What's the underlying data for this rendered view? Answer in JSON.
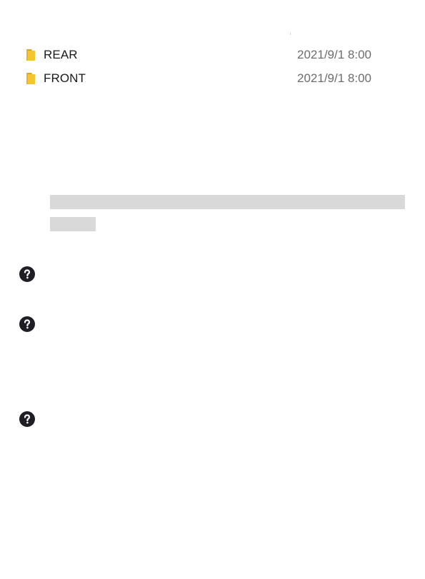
{
  "files": [
    {
      "name": "REAR",
      "modified": "2021/9/1 8:00",
      "icon": "folder-icon"
    },
    {
      "name": "FRONT",
      "modified": "2021/9/1 8:00",
      "icon": "folder-icon"
    }
  ],
  "help_icons": [
    "question-circle-icon",
    "question-circle-icon",
    "question-circle-icon"
  ],
  "colors": {
    "folder": "#f4c431",
    "folder_dark": "#d9a515",
    "redaction": "#d9d9d9",
    "help_icon": "#1e1e24"
  }
}
